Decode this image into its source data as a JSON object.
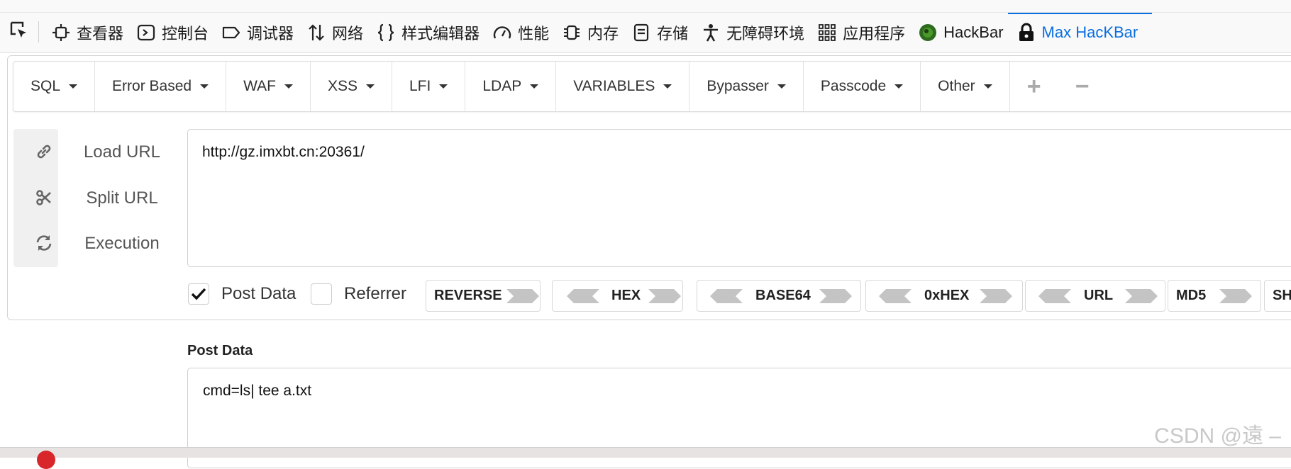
{
  "devtools": {
    "tabs": [
      {
        "label": "查看器",
        "icon": "inspector-icon"
      },
      {
        "label": "控制台",
        "icon": "console-icon"
      },
      {
        "label": "调试器",
        "icon": "debugger-icon"
      },
      {
        "label": "网络",
        "icon": "network-icon"
      },
      {
        "label": "样式编辑器",
        "icon": "braces-icon"
      },
      {
        "label": "性能",
        "icon": "gauge-icon"
      },
      {
        "label": "内存",
        "icon": "memory-icon"
      },
      {
        "label": "存储",
        "icon": "storage-icon"
      },
      {
        "label": "无障碍环境",
        "icon": "accessibility-icon"
      },
      {
        "label": "应用程序",
        "icon": "apps-grid-icon"
      },
      {
        "label": "HackBar",
        "icon": "hackbar-icon"
      },
      {
        "label": "Max HacKBar",
        "icon": "lock-icon",
        "active": true
      }
    ],
    "active_color": "#0a6fe0"
  },
  "menu": {
    "items": [
      "SQL",
      "Error Based",
      "WAF",
      "XSS",
      "LFI",
      "LDAP",
      "VARIABLES",
      "Bypasser",
      "Passcode",
      "Other"
    ],
    "add_label": "+",
    "remove_label": "−"
  },
  "actions": {
    "load_url": "Load URL",
    "split_url": "Split URL",
    "execution": "Execution"
  },
  "url": {
    "value": "http://gz.imxbt.cn:20361/"
  },
  "options": {
    "post_data": {
      "label": "Post Data",
      "checked": true
    },
    "referrer": {
      "label": "Referrer",
      "checked": false
    }
  },
  "encoders": [
    "REVERSE",
    "HEX",
    "BASE64",
    "0xHEX",
    "URL",
    "MD5",
    "SH"
  ],
  "post": {
    "heading": "Post Data",
    "value": "cmd=ls| tee a.txt"
  },
  "watermark": "CSDN @遠 –"
}
